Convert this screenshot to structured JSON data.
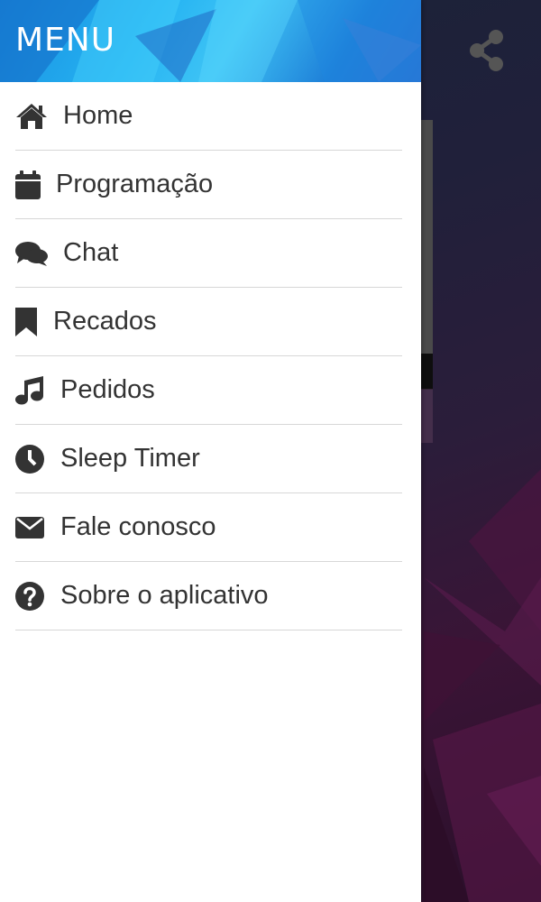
{
  "drawer": {
    "title": "MENU",
    "items": [
      {
        "label": "Home",
        "icon": "home-icon"
      },
      {
        "label": "Programação",
        "icon": "calendar-icon"
      },
      {
        "label": "Chat",
        "icon": "chat-icon"
      },
      {
        "label": "Recados",
        "icon": "bookmark-icon"
      },
      {
        "label": "Pedidos",
        "icon": "music-note-icon"
      },
      {
        "label": "Sleep Timer",
        "icon": "clock-icon"
      },
      {
        "label": "Fale conosco",
        "icon": "envelope-icon"
      },
      {
        "label": "Sobre o aplicativo",
        "icon": "question-circle-icon"
      }
    ]
  },
  "app": {
    "share_icon": "share-icon"
  },
  "colors": {
    "drawer_bg": "#ffffff",
    "text": "#333333",
    "divider": "#d7d7d7",
    "header_blue": "#25b3f2",
    "share_icon": "#555555"
  }
}
